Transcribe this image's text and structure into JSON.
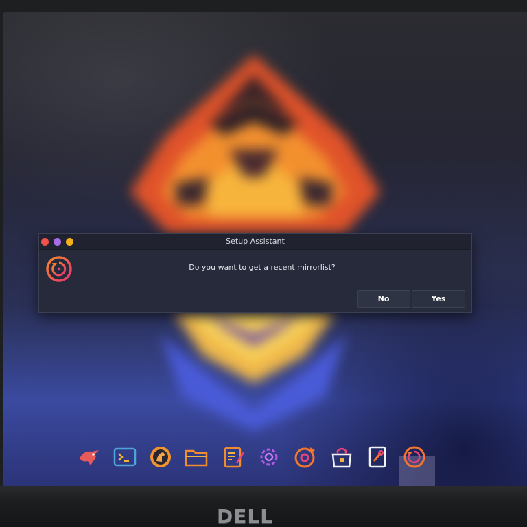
{
  "dialog": {
    "title": "Setup Assistant",
    "message": "Do you want to get a recent mirrorlist?",
    "buttons": {
      "no": "No",
      "yes": "Yes"
    },
    "window_controls": [
      "close",
      "maximize",
      "minimize"
    ]
  },
  "dock": {
    "items": [
      {
        "name": "welcome-app",
        "icon": "eagle-icon"
      },
      {
        "name": "terminal",
        "icon": "terminal-icon"
      },
      {
        "name": "browser",
        "icon": "horse-globe-icon"
      },
      {
        "name": "file-manager",
        "icon": "folder-icon"
      },
      {
        "name": "text-editor",
        "icon": "edit-icon"
      },
      {
        "name": "settings",
        "icon": "gear-icon"
      },
      {
        "name": "updater",
        "icon": "refresh-disc-icon"
      },
      {
        "name": "software-store",
        "icon": "store-bag-icon"
      },
      {
        "name": "tweaks",
        "icon": "tool-card-icon"
      },
      {
        "name": "setup-assistant",
        "icon": "restore-icon",
        "active": true
      }
    ]
  },
  "monitor_brand": "DELL",
  "colors": {
    "accent_orange": "#f2762e",
    "accent_pink": "#e8437a",
    "dialog_bg": "#262a3a"
  }
}
